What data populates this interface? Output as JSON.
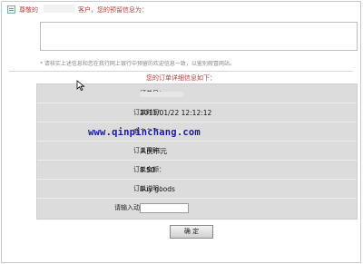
{
  "greeting": {
    "prefix": "尊敬的",
    "suffix": "客户，您的预留信息为："
  },
  "notice": "* 请核实上述信息和您在我行网上银行中预留的欢迎信息一致，以鉴别假冒网站。",
  "order_details": {
    "title": "您的订单详细信息如下：",
    "rows": [
      {
        "label": "订单号：",
        "value": ""
      },
      {
        "label": "订单时间：",
        "value": "2011/01/22 12:12:12"
      },
      {
        "label": "商户名称：",
        "value": ""
      },
      {
        "label": "订单币种：",
        "value": "人民币元"
      },
      {
        "label": "订单金额：",
        "value": "8.50"
      },
      {
        "label": "订单说明：",
        "value": "buy goods"
      },
      {
        "label": "请输入动态口令：",
        "value": ""
      }
    ]
  },
  "watermark": "www.qinpinchang.com",
  "confirm_label": "确  定",
  "colors": {
    "accent": "#b0403a",
    "table_bg": "#dcdcdc",
    "watermark": "#1a1aa0"
  }
}
